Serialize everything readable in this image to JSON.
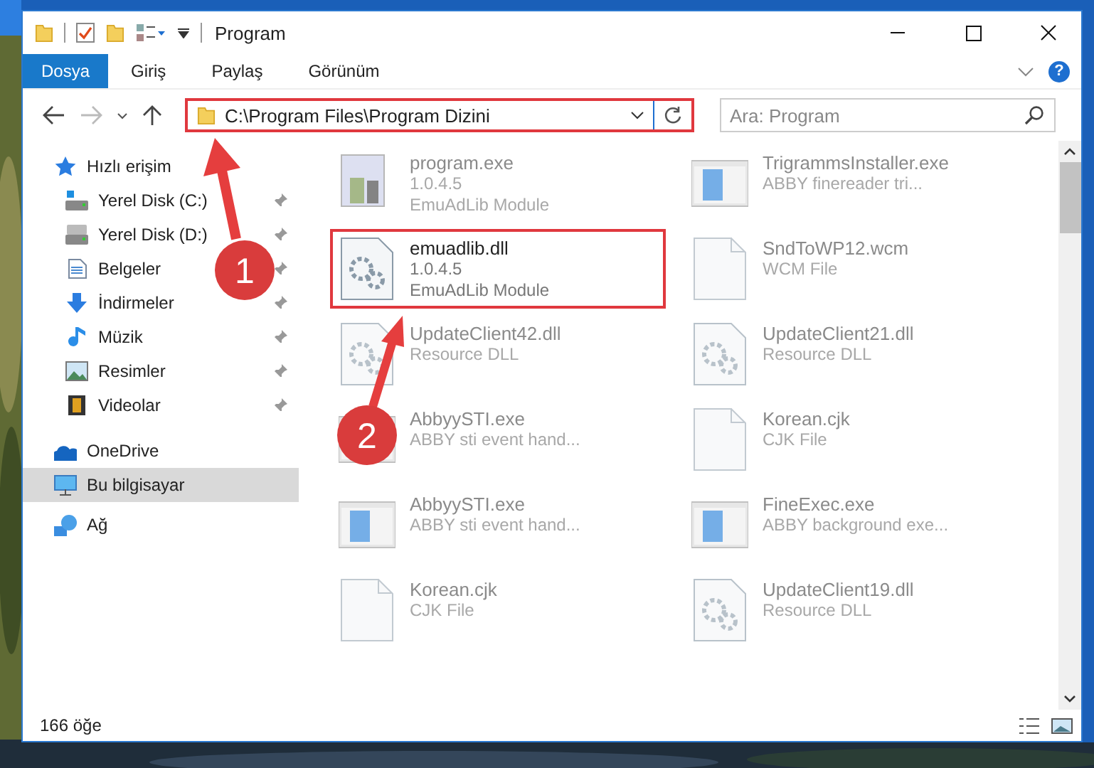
{
  "window": {
    "title": "Program"
  },
  "ribbon": {
    "tabs": [
      {
        "label": "Dosya",
        "selected": true
      },
      {
        "label": "Giriş",
        "selected": false
      },
      {
        "label": "Paylaş",
        "selected": false
      },
      {
        "label": "Görünüm",
        "selected": false
      }
    ],
    "help": "?"
  },
  "address_bar": {
    "path": "C:\\Program Files\\Program Dizini",
    "marked": true
  },
  "search": {
    "placeholder": "Ara: Program"
  },
  "sidebar": {
    "items": [
      {
        "label": "Hızlı erişim",
        "selected": false,
        "children": [
          {
            "label": "Yerel Disk (C:)",
            "pinned": true,
            "selected": false
          },
          {
            "label": "Yerel Disk (D:)",
            "pinned": true,
            "selected": false
          },
          {
            "label": "Belgeler",
            "pinned": true,
            "selected": false
          },
          {
            "label": "İndirmeler",
            "pinned": true,
            "selected": false
          },
          {
            "label": "Müzik",
            "pinned": true,
            "selected": false
          },
          {
            "label": "Resimler",
            "pinned": true,
            "selected": false
          },
          {
            "label": "Videolar",
            "pinned": true,
            "selected": false
          }
        ]
      },
      {
        "label": "OneDrive",
        "selected": false
      },
      {
        "label": "Bu bilgisayar",
        "selected": true
      },
      {
        "label": "Ağ",
        "selected": false
      }
    ]
  },
  "files": [
    {
      "name": "program.exe",
      "details": [
        "1.0.4.5",
        "EmuAdLib Module"
      ],
      "kind": "program",
      "faded": true,
      "marked": false
    },
    {
      "name": "TrigrammsInstaller.exe",
      "details": [
        "ABBY finereader tri..."
      ],
      "kind": "app",
      "faded": true,
      "marked": false
    },
    {
      "name": "emuadlib.dll",
      "details": [
        "1.0.4.5",
        "EmuAdLib Module"
      ],
      "kind": "dll",
      "faded": false,
      "marked": true
    },
    {
      "name": "SndToWP12.wcm",
      "details": [
        "WCM File"
      ],
      "kind": "blank",
      "faded": true,
      "marked": false
    },
    {
      "name": "UpdateClient42.dll",
      "details": [
        "Resource DLL"
      ],
      "kind": "dll",
      "faded": true,
      "marked": false
    },
    {
      "name": "UpdateClient21.dll",
      "details": [
        "Resource DLL"
      ],
      "kind": "dll",
      "faded": true,
      "marked": false
    },
    {
      "name": "AbbyySTI.exe",
      "details": [
        "ABBY sti event hand..."
      ],
      "kind": "app",
      "faded": true,
      "marked": false
    },
    {
      "name": "Korean.cjk",
      "details": [
        "CJK File"
      ],
      "kind": "blank",
      "faded": true,
      "marked": false
    },
    {
      "name": "AbbyySTI.exe",
      "details": [
        "ABBY sti event hand..."
      ],
      "kind": "app",
      "faded": true,
      "marked": false
    },
    {
      "name": "FineExec.exe",
      "details": [
        "ABBY background exe..."
      ],
      "kind": "app",
      "faded": true,
      "marked": false
    },
    {
      "name": "Korean.cjk",
      "details": [
        "CJK File"
      ],
      "kind": "blank",
      "faded": true,
      "marked": false
    },
    {
      "name": "UpdateClient19.dll",
      "details": [
        "Resource DLL"
      ],
      "kind": "dll",
      "faded": true,
      "marked": false
    }
  ],
  "status_bar": {
    "count": "166 öğe"
  },
  "annotations": [
    {
      "number": "1"
    },
    {
      "number": "2"
    }
  ]
}
